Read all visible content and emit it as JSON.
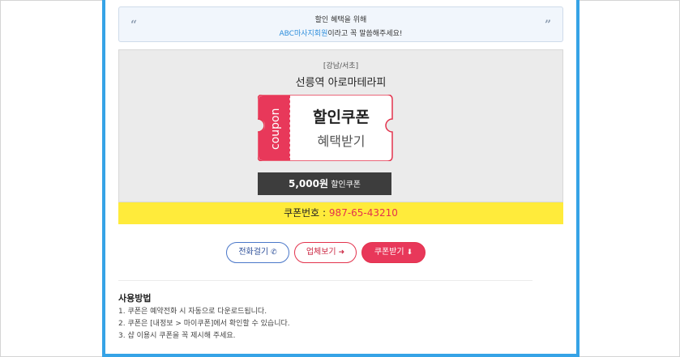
{
  "notice": {
    "line1": "할인 혜택을 위해",
    "accent": "ABC마사지회원",
    "line2_rest": "이라고 꼭 말씀해주세요!",
    "open_quote": "“",
    "close_quote": "”"
  },
  "coupon": {
    "region": "[강남/서초]",
    "shop_name": "선릉역 아로마테라피",
    "side_text": "coupon",
    "main_text": "할인쿠폰",
    "sub_text": "혜택받기",
    "amount": "5,000원",
    "amount_suffix": "할인쿠폰",
    "code_label": "쿠폰번호 :",
    "code_value": "987-65-43210"
  },
  "buttons": {
    "call": "전화걸기",
    "call_icon": "phone-icon",
    "info": "업체보기",
    "info_icon": "arrow-right-icon",
    "get": "쿠폰받기",
    "get_icon": "arrow-down-icon"
  },
  "usage": {
    "title": "사용방법",
    "items": [
      "1. 쿠폰은 예약전화 시 자동으로 다운로드됩니다.",
      "2. 쿠폰은 [내정보 > 마이쿠폰]에서 확인할 수 있습니다.",
      "3. 샵 이용시 쿠폰을 꼭 제시해 주세요."
    ]
  },
  "colors": {
    "frame_border": "#36a3e6",
    "accent_red": "#e8385a",
    "code_bar": "#ffeb3b"
  }
}
